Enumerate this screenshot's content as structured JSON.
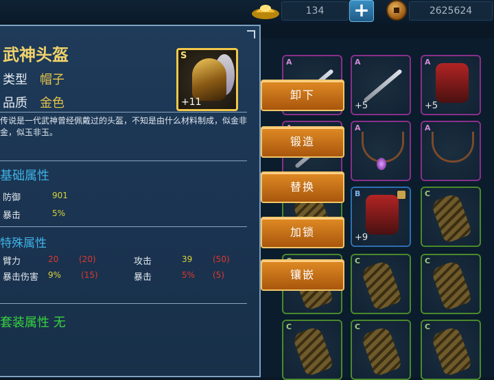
{
  "currency": {
    "ingot_icon": "gold-ingot-icon",
    "ingot_amount": "134",
    "coin_icon": "copper-coin-icon",
    "coin_amount": "2625624",
    "add_label": "+"
  },
  "item": {
    "name": "武神头盔",
    "type_label": "类型",
    "type_value": "帽子",
    "quality_label": "品质",
    "quality_value": "金色",
    "grade": "S",
    "enhance": "+11",
    "description": "传说是一代武神曾经佩戴过的头盔，不知是由什么材料制成，似金非金，似玉非玉。",
    "base_title": "基础属性",
    "base_attrs": [
      {
        "name": "防御",
        "value": "901"
      },
      {
        "name": "暴击",
        "value": "5%"
      }
    ],
    "special_title": "特殊属性",
    "special_attrs": [
      {
        "name": "臂力",
        "value": "20",
        "bonus": "(20)"
      },
      {
        "name": "攻击",
        "value": "39",
        "bonus": "(50)"
      },
      {
        "name": "暴击伤害",
        "value": "9%",
        "bonus": "(15)"
      },
      {
        "name": "暴击",
        "value": "5%",
        "bonus": "(5)"
      }
    ],
    "set_label": "套装属性",
    "set_value": "无"
  },
  "actions": [
    "卸下",
    "锻造",
    "替换",
    "加锁",
    "镶嵌"
  ],
  "inventory": [
    {
      "grade": "A",
      "level": "",
      "quality": "purple",
      "icon": "staff-icon"
    },
    {
      "grade": "A",
      "level": "+5",
      "quality": "purple",
      "icon": "sword-icon"
    },
    {
      "grade": "A",
      "level": "+5",
      "quality": "purple",
      "icon": "armor-icon"
    },
    {
      "grade": "A",
      "level": "",
      "quality": "purple",
      "icon": "weapon-icon"
    },
    {
      "grade": "A",
      "level": "",
      "quality": "purple",
      "icon": "amulet-icon"
    },
    {
      "grade": "A",
      "level": "",
      "quality": "purple",
      "icon": "necklace-icon"
    },
    {
      "grade": "",
      "level": "",
      "quality": "green",
      "icon": "gauntlet-icon"
    },
    {
      "grade": "B",
      "level": "+9",
      "quality": "blue",
      "icon": "armor-icon"
    },
    {
      "grade": "C",
      "level": "",
      "quality": "green",
      "icon": "gauntlet-icon"
    },
    {
      "grade": "C",
      "level": "",
      "quality": "green",
      "icon": "gauntlet-icon"
    },
    {
      "grade": "C",
      "level": "",
      "quality": "green",
      "icon": "gauntlet-icon"
    },
    {
      "grade": "C",
      "level": "",
      "quality": "green",
      "icon": "gauntlet-icon"
    },
    {
      "grade": "C",
      "level": "",
      "quality": "green",
      "icon": "gauntlet-icon"
    },
    {
      "grade": "C",
      "level": "",
      "quality": "green",
      "icon": "gauntlet-icon"
    },
    {
      "grade": "C",
      "level": "",
      "quality": "green",
      "icon": "gauntlet-icon"
    }
  ]
}
